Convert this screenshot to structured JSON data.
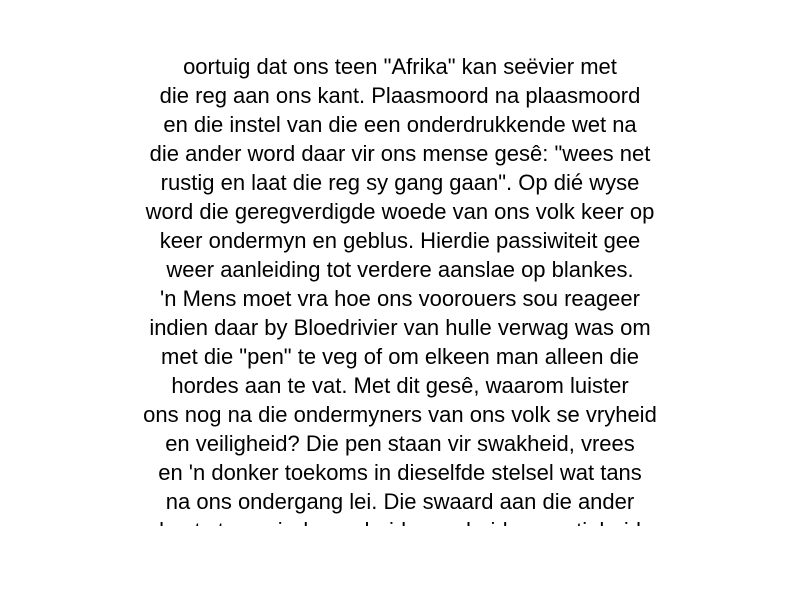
{
  "document": {
    "lines": [
      "oortuig dat ons teen \"Afrika\" kan seëvier met",
      "die reg aan ons kant. Plaasmoord na plaasmoord",
      "en die instel van die een onderdrukkende wet na",
      "die ander word daar vir ons mense gesê: \"wees net",
      "rustig en laat die reg sy gang gaan\". Op dié wyse",
      "word die geregverdigde woede van ons volk keer op",
      "keer ondermyn en geblus. Hierdie passiwiteit gee",
      "weer aanleiding tot verdere aanslae op blankes.",
      "'n Mens moet vra hoe ons voorouers sou reageer",
      "indien daar by Bloedrivier van hulle verwag was om",
      "met die \"pen\" te veg of om elkeen man alleen die",
      "hordes aan te vat. Met dit gesê, waarom luister",
      "ons nog na die ondermyners van ons volk se vryheid",
      "en veiligheid? Die pen staan vir swakheid, vrees",
      "en 'n donker toekoms in dieselfde stelsel wat tans",
      "na ons ondergang lei. Die swaard aan die ander",
      "kant staan vir dapperheid, waarheid, geregtigheid"
    ]
  }
}
